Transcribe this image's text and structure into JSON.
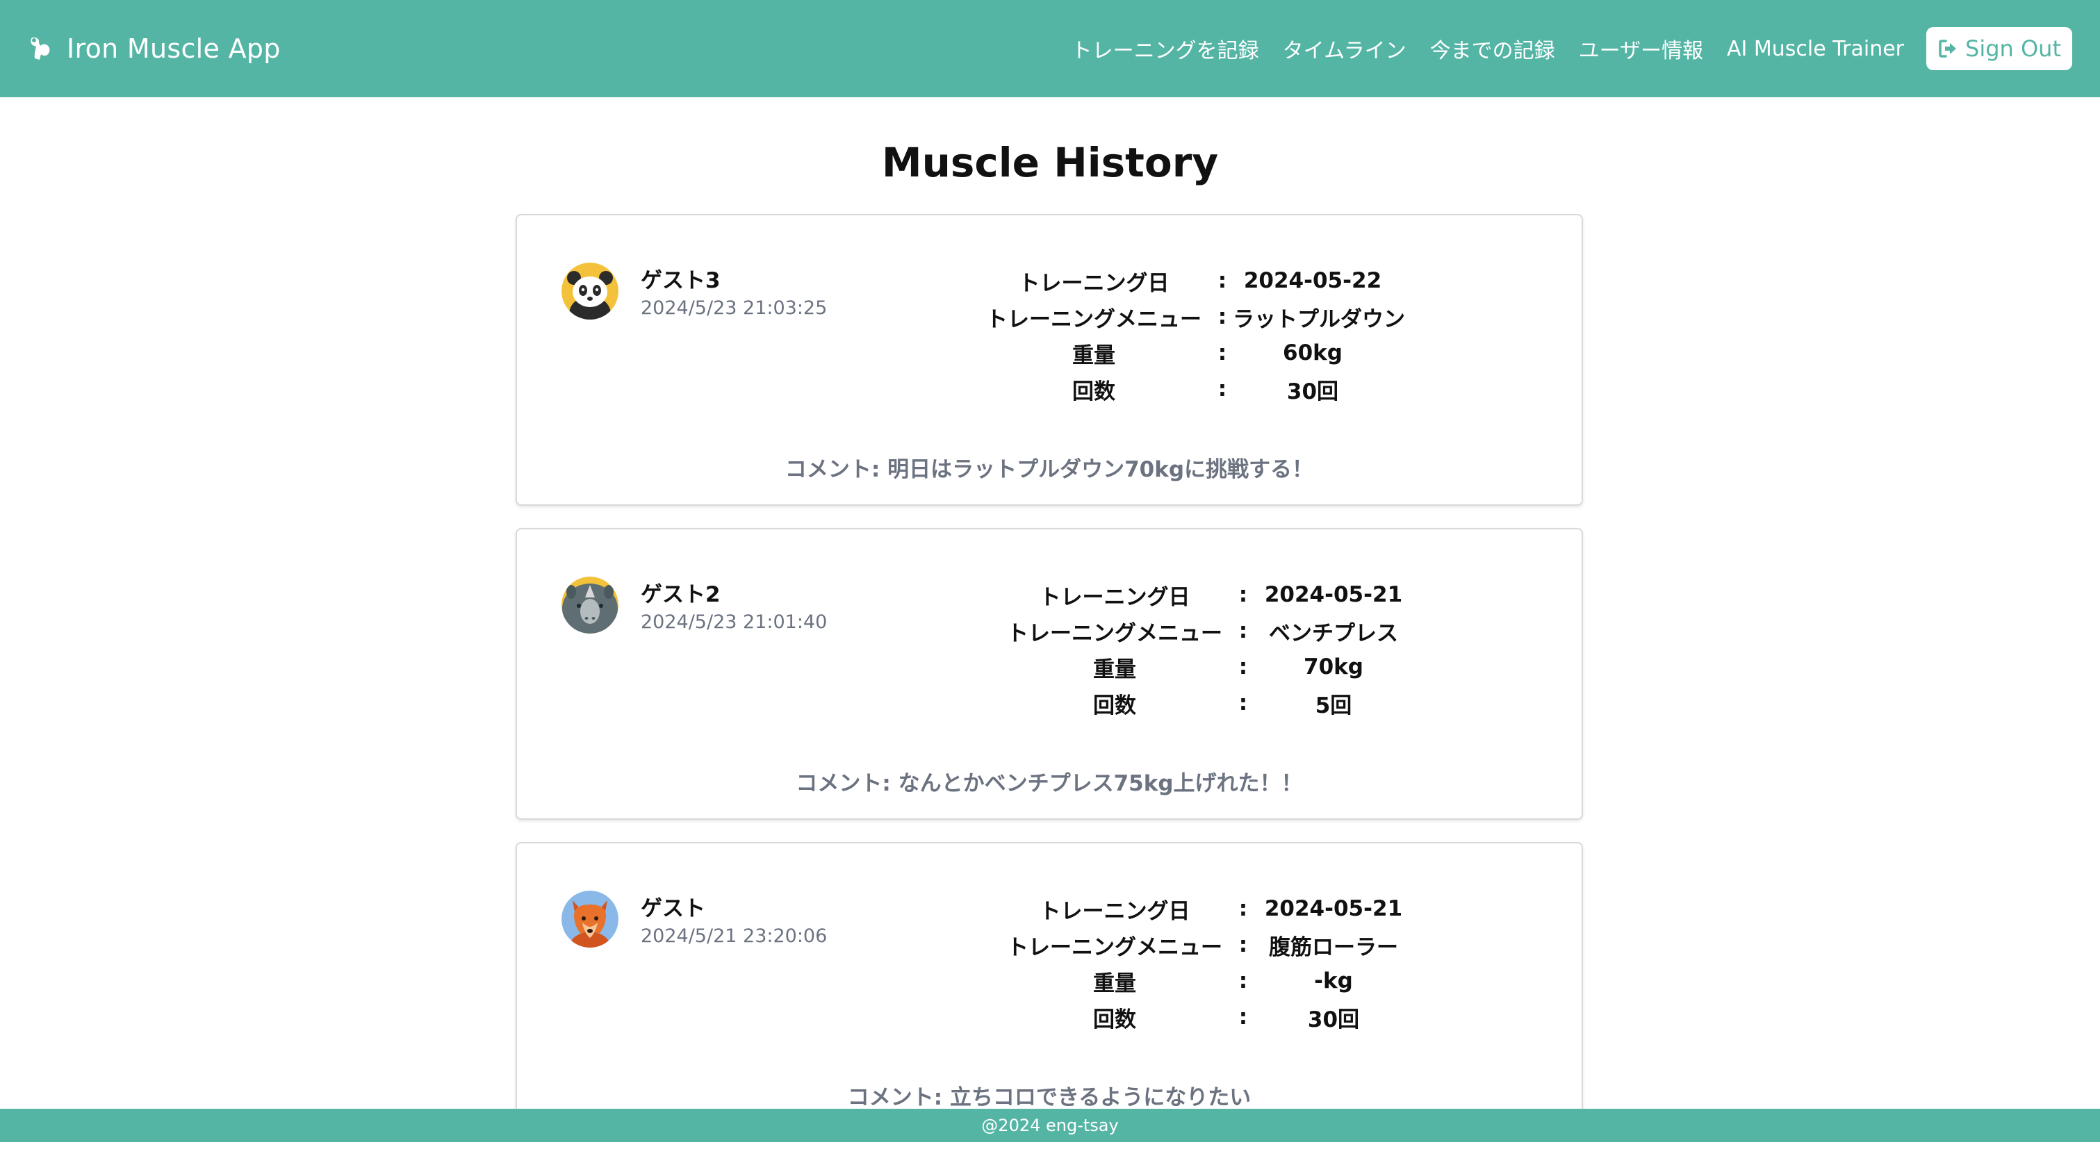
{
  "header": {
    "app_name": "Iron Muscle App",
    "brand_icon": "flexed-arm-icon",
    "nav": [
      "トレーニングを記録",
      "タイムライン",
      "今までの記録",
      "ユーザー情報",
      "AI Muscle Trainer"
    ],
    "signout_label": "Sign Out",
    "signout_icon": "sign-out-icon"
  },
  "page": {
    "title": "Muscle History"
  },
  "labels": {
    "date": "トレーニング日",
    "menu": "トレーニングメニュー",
    "weight": "重量",
    "reps": "回数",
    "separator": ":"
  },
  "posts": [
    {
      "user": "ゲスト3",
      "timestamp": "2024/5/23 21:03:25",
      "avatar": "panda-icon",
      "date": "2024-05-22",
      "menu": "ラットプルダウン",
      "weight": "60kg",
      "reps": "30回",
      "comment": "コメント: 明日はラットプルダウン70kgに挑戦する！"
    },
    {
      "user": "ゲスト2",
      "timestamp": "2024/5/23 21:01:40",
      "avatar": "rhino-icon",
      "date": "2024-05-21",
      "menu": "ベンチプレス",
      "weight": "70kg",
      "reps": "5回",
      "comment": "コメント: なんとかベンチプレス75kg上げれた！！"
    },
    {
      "user": "ゲスト",
      "timestamp": "2024/5/21 23:20:06",
      "avatar": "fox-icon",
      "date": "2024-05-21",
      "menu": "腹筋ローラー",
      "weight": "-kg",
      "reps": "30回",
      "comment": "コメント: 立ちコロできるようになりたい"
    }
  ],
  "footer": {
    "text": "@2024 eng-tsay"
  },
  "colors": {
    "primary": "#55b5a5",
    "muted_text": "#6b7280",
    "card_border": "#d9d9d9"
  }
}
